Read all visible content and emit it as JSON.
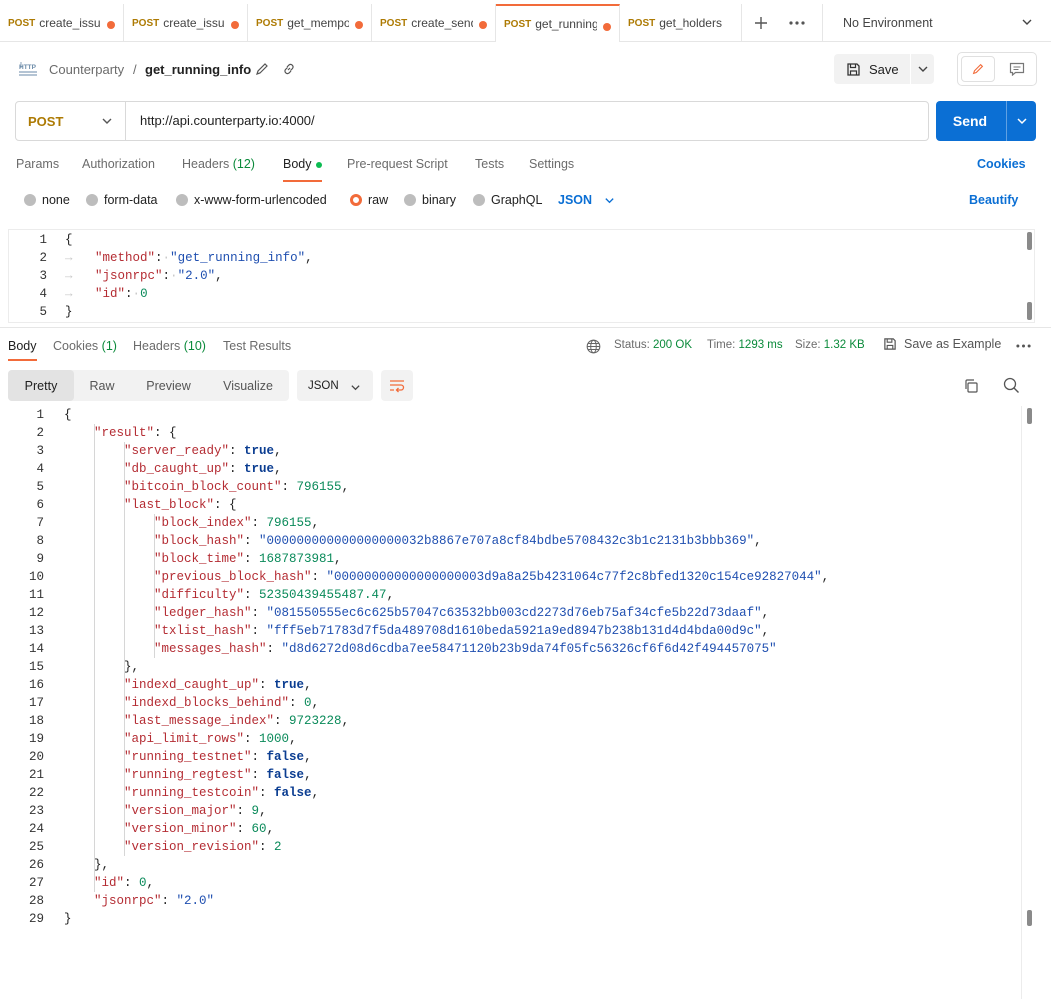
{
  "tabs": [
    {
      "method": "POST",
      "name": "create_issua",
      "dot": true,
      "active": false
    },
    {
      "method": "POST",
      "name": "create_issua",
      "dot": true,
      "active": false
    },
    {
      "method": "POST",
      "name": "get_mempo",
      "dot": true,
      "active": false
    },
    {
      "method": "POST",
      "name": "create_send",
      "dot": true,
      "active": false
    },
    {
      "method": "POST",
      "name": "get_running_",
      "dot": true,
      "active": true
    },
    {
      "method": "POST",
      "name": "get_holders",
      "dot": false,
      "active": false
    }
  ],
  "environment": "No Environment",
  "breadcrumb": {
    "parent": "Counterparty",
    "separator": "/",
    "title": "get_running_info"
  },
  "toolbar": {
    "save_label": "Save"
  },
  "request": {
    "method": "POST",
    "url": "http://api.counterparty.io:4000/",
    "send_label": "Send"
  },
  "request_tabs": {
    "params": "Params",
    "authorization": "Authorization",
    "headers": "Headers",
    "headers_count": "(12)",
    "body": "Body",
    "prerequest": "Pre-request Script",
    "tests": "Tests",
    "settings": "Settings",
    "cookies": "Cookies"
  },
  "body_types": {
    "none": "none",
    "form_data": "form-data",
    "urlencoded": "x-www-form-urlencoded",
    "raw": "raw",
    "binary": "binary",
    "graphql": "GraphQL",
    "format": "JSON",
    "beautify": "Beautify",
    "selected": "raw"
  },
  "request_body_lines": [
    [
      [
        "p",
        "{"
      ]
    ],
    [
      [
        "w",
        "→   "
      ],
      [
        "k",
        "\"method\""
      ],
      [
        "p",
        ":"
      ],
      [
        "w",
        "·"
      ],
      [
        "s",
        "\"get_running_info\""
      ],
      [
        "p",
        ","
      ]
    ],
    [
      [
        "w",
        "→   "
      ],
      [
        "k",
        "\"jsonrpc\""
      ],
      [
        "p",
        ":"
      ],
      [
        "w",
        "·"
      ],
      [
        "s",
        "\"2.0\""
      ],
      [
        "p",
        ","
      ]
    ],
    [
      [
        "w",
        "→   "
      ],
      [
        "k",
        "\"id\""
      ],
      [
        "p",
        ":"
      ],
      [
        "w",
        "·"
      ],
      [
        "n",
        "0"
      ]
    ],
    [
      [
        "p",
        "}"
      ]
    ]
  ],
  "response_tabs": {
    "body": "Body",
    "cookies": "Cookies",
    "cookies_count": "(1)",
    "headers": "Headers",
    "headers_count": "(10)",
    "test_results": "Test Results"
  },
  "response_status": {
    "status_label": "Status:",
    "status_value": "200 OK",
    "time_label": "Time:",
    "time_value": "1293 ms",
    "size_label": "Size:",
    "size_value": "1.32 KB",
    "save_example": "Save as Example"
  },
  "response_views": {
    "pretty": "Pretty",
    "raw": "Raw",
    "preview": "Preview",
    "visualize": "Visualize",
    "format": "JSON"
  },
  "response_body_lines": [
    {
      "indent": 0,
      "tokens": [
        [
          "p",
          "{"
        ]
      ]
    },
    {
      "indent": 1,
      "tokens": [
        [
          "k",
          "\"result\""
        ],
        [
          "p",
          ": {"
        ]
      ]
    },
    {
      "indent": 2,
      "tokens": [
        [
          "k",
          "\"server_ready\""
        ],
        [
          "p",
          ": "
        ],
        [
          "b",
          "true"
        ],
        [
          "p",
          ","
        ]
      ]
    },
    {
      "indent": 2,
      "tokens": [
        [
          "k",
          "\"db_caught_up\""
        ],
        [
          "p",
          ": "
        ],
        [
          "b",
          "true"
        ],
        [
          "p",
          ","
        ]
      ]
    },
    {
      "indent": 2,
      "tokens": [
        [
          "k",
          "\"bitcoin_block_count\""
        ],
        [
          "p",
          ": "
        ],
        [
          "n",
          "796155"
        ],
        [
          "p",
          ","
        ]
      ]
    },
    {
      "indent": 2,
      "tokens": [
        [
          "k",
          "\"last_block\""
        ],
        [
          "p",
          ": {"
        ]
      ]
    },
    {
      "indent": 3,
      "tokens": [
        [
          "k",
          "\"block_index\""
        ],
        [
          "p",
          ": "
        ],
        [
          "n",
          "796155"
        ],
        [
          "p",
          ","
        ]
      ]
    },
    {
      "indent": 3,
      "tokens": [
        [
          "k",
          "\"block_hash\""
        ],
        [
          "p",
          ": "
        ],
        [
          "s",
          "\"000000000000000000032b8867e707a8cf84bdbe5708432c3b1c2131b3bbb369\""
        ],
        [
          "p",
          ","
        ]
      ]
    },
    {
      "indent": 3,
      "tokens": [
        [
          "k",
          "\"block_time\""
        ],
        [
          "p",
          ": "
        ],
        [
          "n",
          "1687873981"
        ],
        [
          "p",
          ","
        ]
      ]
    },
    {
      "indent": 3,
      "tokens": [
        [
          "k",
          "\"previous_block_hash\""
        ],
        [
          "p",
          ": "
        ],
        [
          "s",
          "\"00000000000000000003d9a8a25b4231064c77f2c8bfed1320c154ce92827044\""
        ],
        [
          "p",
          ","
        ]
      ]
    },
    {
      "indent": 3,
      "tokens": [
        [
          "k",
          "\"difficulty\""
        ],
        [
          "p",
          ": "
        ],
        [
          "n",
          "52350439455487.47"
        ],
        [
          "p",
          ","
        ]
      ]
    },
    {
      "indent": 3,
      "tokens": [
        [
          "k",
          "\"ledger_hash\""
        ],
        [
          "p",
          ": "
        ],
        [
          "s",
          "\"081550555ec6c625b57047c63532bb003cd2273d76eb75af34cfe5b22d73daaf\""
        ],
        [
          "p",
          ","
        ]
      ]
    },
    {
      "indent": 3,
      "tokens": [
        [
          "k",
          "\"txlist_hash\""
        ],
        [
          "p",
          ": "
        ],
        [
          "s",
          "\"fff5eb71783d7f5da489708d1610beda5921a9ed8947b238b131d4d4bda00d9c\""
        ],
        [
          "p",
          ","
        ]
      ]
    },
    {
      "indent": 3,
      "tokens": [
        [
          "k",
          "\"messages_hash\""
        ],
        [
          "p",
          ": "
        ],
        [
          "s",
          "\"d8d6272d08d6cdba7ee58471120b23b9da74f05fc56326cf6f6d42f494457075\""
        ]
      ]
    },
    {
      "indent": 2,
      "tokens": [
        [
          "p",
          "},"
        ]
      ]
    },
    {
      "indent": 2,
      "tokens": [
        [
          "k",
          "\"indexd_caught_up\""
        ],
        [
          "p",
          ": "
        ],
        [
          "b",
          "true"
        ],
        [
          "p",
          ","
        ]
      ]
    },
    {
      "indent": 2,
      "tokens": [
        [
          "k",
          "\"indexd_blocks_behind\""
        ],
        [
          "p",
          ": "
        ],
        [
          "n",
          "0"
        ],
        [
          "p",
          ","
        ]
      ]
    },
    {
      "indent": 2,
      "tokens": [
        [
          "k",
          "\"last_message_index\""
        ],
        [
          "p",
          ": "
        ],
        [
          "n",
          "9723228"
        ],
        [
          "p",
          ","
        ]
      ]
    },
    {
      "indent": 2,
      "tokens": [
        [
          "k",
          "\"api_limit_rows\""
        ],
        [
          "p",
          ": "
        ],
        [
          "n",
          "1000"
        ],
        [
          "p",
          ","
        ]
      ]
    },
    {
      "indent": 2,
      "tokens": [
        [
          "k",
          "\"running_testnet\""
        ],
        [
          "p",
          ": "
        ],
        [
          "b",
          "false"
        ],
        [
          "p",
          ","
        ]
      ]
    },
    {
      "indent": 2,
      "tokens": [
        [
          "k",
          "\"running_regtest\""
        ],
        [
          "p",
          ": "
        ],
        [
          "b",
          "false"
        ],
        [
          "p",
          ","
        ]
      ]
    },
    {
      "indent": 2,
      "tokens": [
        [
          "k",
          "\"running_testcoin\""
        ],
        [
          "p",
          ": "
        ],
        [
          "b",
          "false"
        ],
        [
          "p",
          ","
        ]
      ]
    },
    {
      "indent": 2,
      "tokens": [
        [
          "k",
          "\"version_major\""
        ],
        [
          "p",
          ": "
        ],
        [
          "n",
          "9"
        ],
        [
          "p",
          ","
        ]
      ]
    },
    {
      "indent": 2,
      "tokens": [
        [
          "k",
          "\"version_minor\""
        ],
        [
          "p",
          ": "
        ],
        [
          "n",
          "60"
        ],
        [
          "p",
          ","
        ]
      ]
    },
    {
      "indent": 2,
      "tokens": [
        [
          "k",
          "\"version_revision\""
        ],
        [
          "p",
          ": "
        ],
        [
          "n",
          "2"
        ]
      ]
    },
    {
      "indent": 1,
      "tokens": [
        [
          "p",
          "},"
        ]
      ]
    },
    {
      "indent": 1,
      "tokens": [
        [
          "k",
          "\"id\""
        ],
        [
          "p",
          ": "
        ],
        [
          "n",
          "0"
        ],
        [
          "p",
          ","
        ]
      ]
    },
    {
      "indent": 1,
      "tokens": [
        [
          "k",
          "\"jsonrpc\""
        ],
        [
          "p",
          ": "
        ],
        [
          "s",
          "\"2.0\""
        ]
      ]
    },
    {
      "indent": 0,
      "tokens": [
        [
          "p",
          "}"
        ]
      ]
    }
  ],
  "icons": {
    "http": "http-icon",
    "edit": "pencil-icon",
    "link": "link-icon",
    "save": "floppy-disk-icon",
    "globe": "globe-icon",
    "copy": "copy-icon",
    "search": "search-icon",
    "wrap": "wrap-lines-icon",
    "more": "more-horizontal-icon",
    "add": "plus-icon"
  },
  "colors": {
    "accent": "#f26b3a",
    "primary": "#0b6fd4",
    "method_post": "#ad7a03",
    "status_ok": "#0a8a3a",
    "json_key": "#b42c33",
    "json_string": "#1f4fb0",
    "json_number": "#0a8a5a"
  }
}
